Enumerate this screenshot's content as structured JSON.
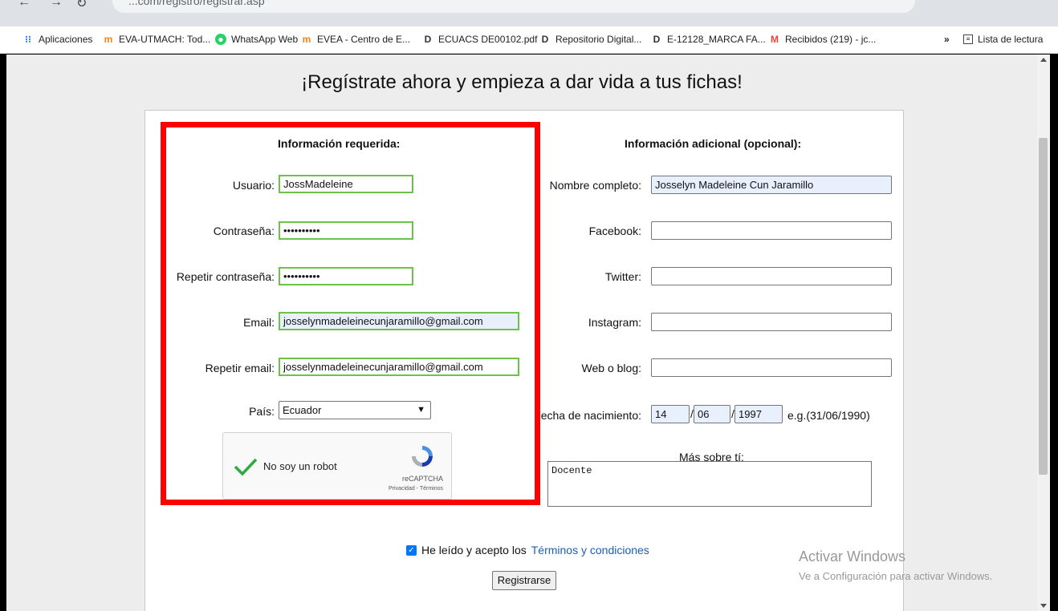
{
  "browser": {
    "url_text": "...com/registro/registrar.asp",
    "bookmarks": [
      {
        "label": "Aplicaciones",
        "icon": "apps-grid-icon"
      },
      {
        "label": "EVA-UTMACH: Tod...",
        "icon": "moodle-icon"
      },
      {
        "label": "WhatsApp Web",
        "icon": "whatsapp-icon"
      },
      {
        "label": "EVEA - Centro de E...",
        "icon": "moodle-icon"
      },
      {
        "label": "ECUACS DE00102.pdf",
        "icon": "document-icon"
      },
      {
        "label": "Repositorio Digital...",
        "icon": "document-icon"
      },
      {
        "label": "E-12128_MARCA FA...",
        "icon": "document-icon"
      },
      {
        "label": "Recibidos (219) - jc...",
        "icon": "gmail-icon"
      }
    ],
    "more": "»",
    "reading_list": "Lista de lectura"
  },
  "page": {
    "heading": "¡Regístrate ahora y empieza a dar vida a tus fichas!"
  },
  "required": {
    "title": "Información requerida:",
    "usuario_label": "Usuario:",
    "usuario_value": "JossMadeleine",
    "password_label": "Contraseña:",
    "password_value": "••••••••••",
    "repeat_password_label": "Repetir contraseña:",
    "repeat_password_value": "••••••••••",
    "email_label": "Email:",
    "email_value": "josselynmadeleinecunjaramillo@gmail.com",
    "repeat_email_label": "Repetir email:",
    "repeat_email_value": "josselynmadeleinecunjaramillo@gmail.com",
    "country_label": "País:",
    "country_value": "Ecuador"
  },
  "recaptcha": {
    "label": "No soy un robot",
    "brand": "reCAPTCHA",
    "links": "Privacidad - Términos"
  },
  "optional": {
    "title": "Información adicional (opcional):",
    "fullname_label": "Nombre completo:",
    "fullname_value": "Josselyn Madeleine Cun Jaramillo",
    "facebook_label": "Facebook:",
    "facebook_value": "",
    "twitter_label": "Twitter:",
    "twitter_value": "",
    "instagram_label": "Instagram:",
    "instagram_value": "",
    "web_label": "Web o blog:",
    "web_value": "",
    "birth_label": "echa de nacimiento:",
    "birth_day": "14",
    "birth_month": "06",
    "birth_year": "1997",
    "birth_hint": "e.g.(31/06/1990)",
    "about_label": "Más sobre tí:",
    "about_value": "Docente"
  },
  "terms": {
    "text": "He leído y acepto los",
    "link": "Términos y condiciones"
  },
  "register_button": "Registrarse",
  "windows_watermark": {
    "line1": "Activar Windows",
    "line2": "Ve a Configuración para activar Windows."
  }
}
